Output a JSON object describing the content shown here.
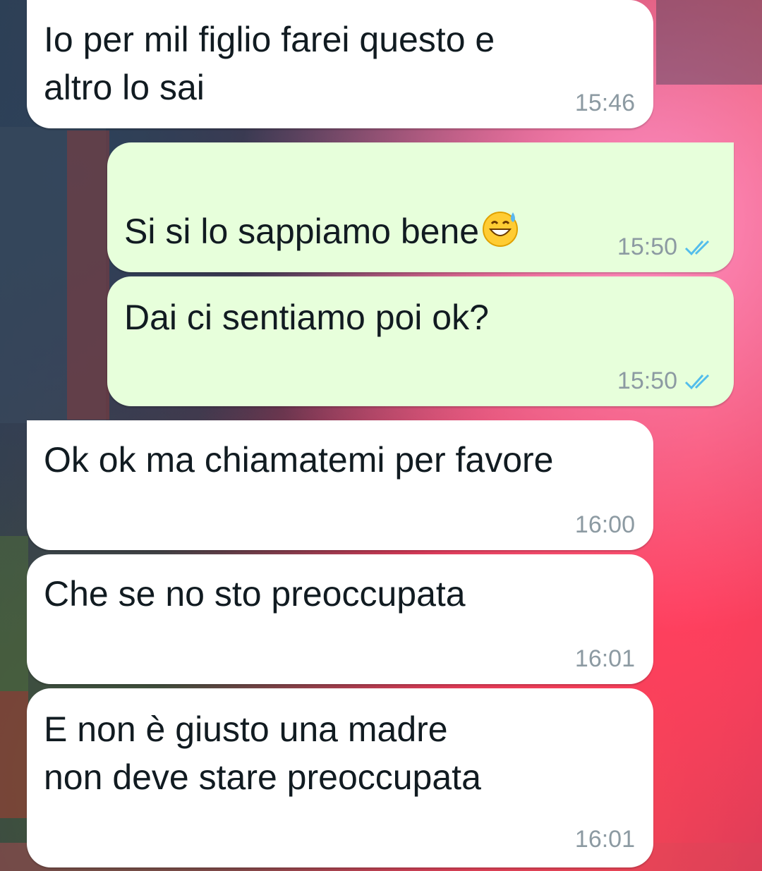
{
  "messages": [
    {
      "direction": "incoming",
      "text": "Io per mil figlio farei questo e\naltro lo sai",
      "time": "15:46"
    },
    {
      "direction": "outgoing",
      "text": "Si si lo sappiamo bene",
      "emoji": "grinning-face-with-sweat",
      "time": "15:50",
      "status": "read"
    },
    {
      "direction": "outgoing",
      "text": "Dai ci sentiamo poi ok?",
      "time": "15:50",
      "status": "read"
    },
    {
      "direction": "incoming",
      "text": "Ok ok ma chiamatemi per favore",
      "time": "16:00"
    },
    {
      "direction": "incoming",
      "text": "Che se no sto preoccupata",
      "time": "16:01"
    },
    {
      "direction": "incoming",
      "text": "E non è giusto una madre\nnon deve stare preoccupata",
      "time": "16:01"
    }
  ],
  "colors": {
    "incoming_bubble": "#ffffff",
    "outgoing_bubble": "#e7ffdb",
    "read_tick": "#53bdeb",
    "timestamp": "#8c9aa2"
  }
}
